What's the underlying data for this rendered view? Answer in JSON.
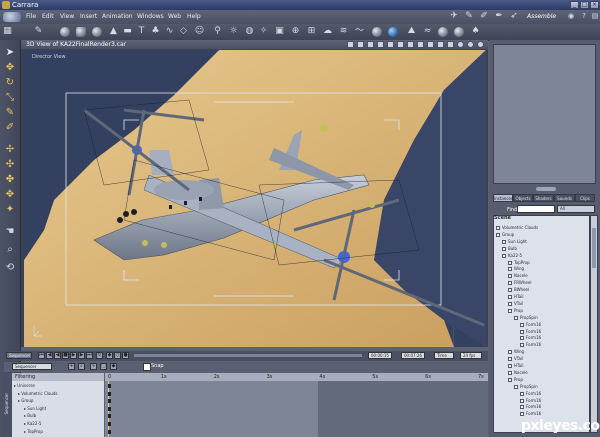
{
  "app": {
    "title": "Carrara"
  },
  "menu": {
    "items": [
      "File",
      "Edit",
      "View",
      "Insert",
      "Animation",
      "Windows",
      "Web",
      "Help"
    ],
    "room_label": "Assemble"
  },
  "viewport": {
    "title": "3D View of KA22FinalRender3.car",
    "corner_label": "Director View"
  },
  "right_panel": {
    "tabs": [
      "Instances",
      "Objects",
      "Shaders",
      "Sounds",
      "Clips"
    ],
    "active_tab": "Instances",
    "find_label": "Find",
    "find_value": "",
    "find_scope": "All",
    "tree_title": "Scene",
    "tree": [
      {
        "label": "Volumetric Clouds",
        "depth": 0
      },
      {
        "label": "Group",
        "depth": 0
      },
      {
        "label": "Sun Light",
        "depth": 1
      },
      {
        "label": "Bulb",
        "depth": 1
      },
      {
        "label": "Ka22-5",
        "depth": 1
      },
      {
        "label": "TopProp",
        "depth": 2
      },
      {
        "label": "Wing",
        "depth": 2
      },
      {
        "label": "Nacele",
        "depth": 2
      },
      {
        "label": "FRWheel",
        "depth": 2
      },
      {
        "label": "BWheel",
        "depth": 2
      },
      {
        "label": "HTail",
        "depth": 2
      },
      {
        "label": "VTail",
        "depth": 2
      },
      {
        "label": "Prop",
        "depth": 2
      },
      {
        "label": "PropSpin",
        "depth": 3
      },
      {
        "label": "Form16",
        "depth": 4
      },
      {
        "label": "Form16",
        "depth": 4
      },
      {
        "label": "Form16",
        "depth": 4
      },
      {
        "label": "Form16",
        "depth": 4
      },
      {
        "label": "Wing",
        "depth": 2
      },
      {
        "label": "VTail",
        "depth": 2
      },
      {
        "label": "HTail",
        "depth": 2
      },
      {
        "label": "Nacele",
        "depth": 2
      },
      {
        "label": "Prop",
        "depth": 2
      },
      {
        "label": "PropSpin",
        "depth": 3
      },
      {
        "label": "Form16",
        "depth": 4
      },
      {
        "label": "Form16",
        "depth": 4
      },
      {
        "label": "Form16",
        "depth": 4
      },
      {
        "label": "Form16",
        "depth": 4
      }
    ]
  },
  "timeline": {
    "tab_label": "Sequencer",
    "time_current": "00:00:15",
    "time_end": "00:07:26",
    "time_mode": "Time",
    "fps": "24 fps",
    "snap_label": "Snap",
    "filtering_label": "Filtering",
    "side_label": "Sequencer",
    "ruler_ticks": [
      "0",
      "1s",
      "2s",
      "3s",
      "4s",
      "5s",
      "6s",
      "7s"
    ],
    "tracks": [
      "Universe",
      "Volumetric Clouds",
      "Group",
      "Sun Light",
      "Bulb",
      "Ka22-5",
      "TopProp"
    ]
  },
  "watermark": "pxleyes.com"
}
